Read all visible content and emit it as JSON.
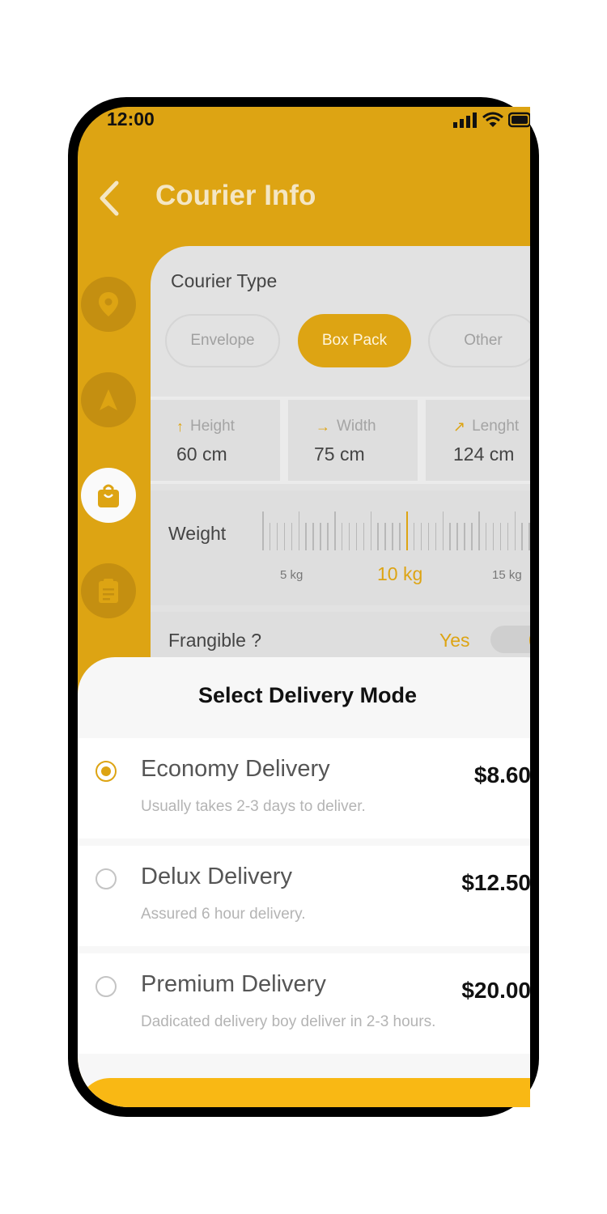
{
  "status_bar": {
    "time": "12:00"
  },
  "header": {
    "title": "Courier Info"
  },
  "rail": {
    "items": [
      {
        "icon": "location-pin-icon",
        "active": false
      },
      {
        "icon": "navigation-arrow-icon",
        "active": false
      },
      {
        "icon": "shopping-bag-icon",
        "active": true
      },
      {
        "icon": "clipboard-icon",
        "active": false
      }
    ]
  },
  "courier_type": {
    "label": "Courier Type",
    "options": [
      "Envelope",
      "Box Pack",
      "Other"
    ],
    "selected": "Box Pack"
  },
  "dimensions": [
    {
      "label": "Height",
      "value": "60 cm"
    },
    {
      "label": "Width",
      "value": "75 cm"
    },
    {
      "label": "Lenght",
      "value": "124 cm"
    }
  ],
  "weight": {
    "label": "Weight",
    "scale_labels": [
      "5 kg",
      "10 kg",
      "15 kg"
    ],
    "selected": "10 kg"
  },
  "frangible": {
    "label": "Frangible ?",
    "value": "Yes",
    "on": true
  },
  "delivery": {
    "title": "Select Delivery Mode",
    "options": [
      {
        "name": "Economy Delivery",
        "desc": "Usually takes 2-3 days to deliver.",
        "price": "$8.60",
        "selected": true
      },
      {
        "name": "Delux Delivery",
        "desc": "Assured 6 hour delivery.",
        "price": "$12.50",
        "selected": false
      },
      {
        "name": "Premium Delivery",
        "desc": "Dadicated delivery boy deliver in 2-3 hours.",
        "price": "$20.00",
        "selected": false
      }
    ]
  },
  "colors": {
    "accent": "#DDA413",
    "cta": "#F9B814"
  }
}
